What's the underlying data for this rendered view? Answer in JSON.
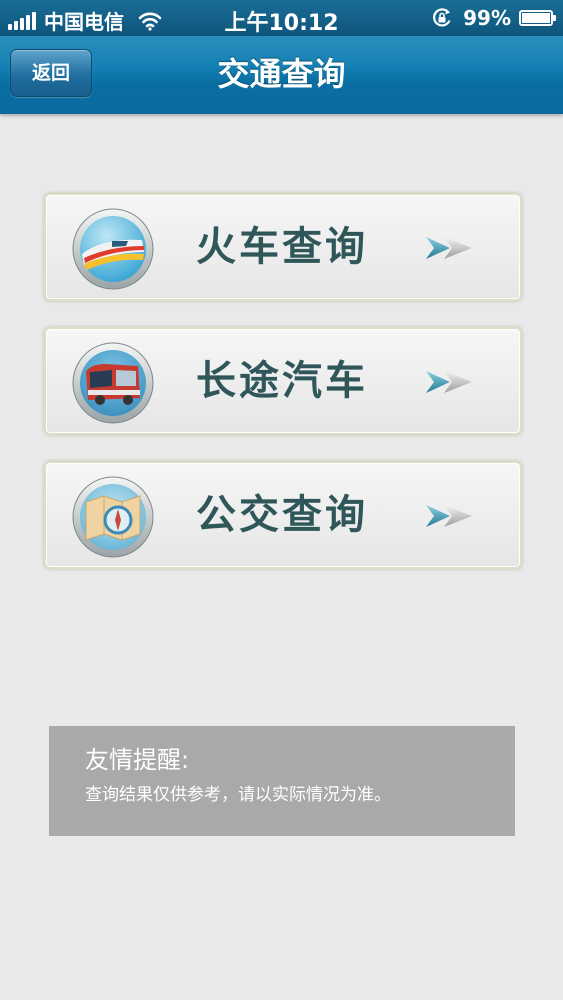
{
  "status_bar": {
    "carrier": "中国电信",
    "time": "上午10:12",
    "battery": "99%",
    "battery_level": 0.99
  },
  "nav": {
    "back_label": "返回",
    "title": "交通查询"
  },
  "menu": [
    {
      "label": "火车查询",
      "icon": "train-icon"
    },
    {
      "label": "长途汽车",
      "icon": "bus-icon"
    },
    {
      "label": "公交查询",
      "icon": "map-compass-icon"
    }
  ],
  "notice": {
    "title": "友情提醒:",
    "text": "查询结果仅供参考，请以实际情况为准。"
  },
  "colors": {
    "nav_bar": "#1480b3",
    "status_bar": "#0e557c",
    "label": "#2f5659",
    "arrow": "#2e8aa3",
    "notice_bg": "#a9a8aa",
    "page_bg": "#e9e8ea"
  }
}
